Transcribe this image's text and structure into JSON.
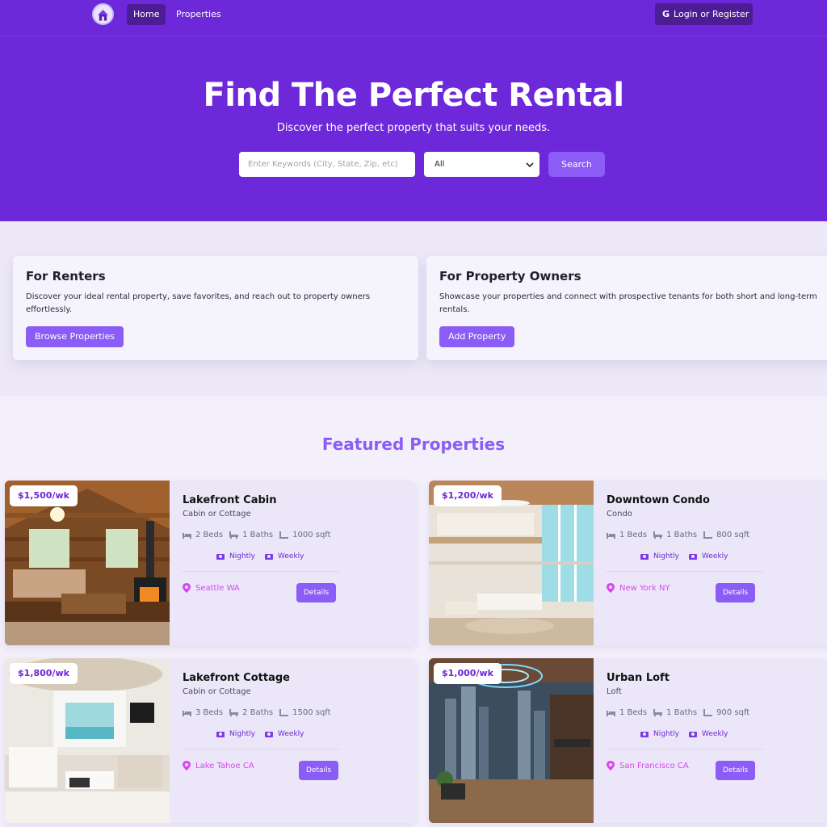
{
  "nav": {
    "logo_icon": "house-logo-icon",
    "links": [
      {
        "label": "Home",
        "active": true
      },
      {
        "label": "Properties",
        "active": false
      }
    ],
    "login_label": "Login or Register",
    "login_icon": "google-icon"
  },
  "hero": {
    "title": "Find The Perfect Rental",
    "subtitle": "Discover the perfect property that suits your needs.",
    "search_placeholder": "Enter Keywords (City, State, Zip, etc)",
    "type_selected": "All",
    "search_button": "Search"
  },
  "info": {
    "renters": {
      "title": "For Renters",
      "text": "Discover your ideal rental property, save favorites, and reach out to property owners effortlessly.",
      "button": "Browse Properties"
    },
    "owners": {
      "title": "For Property Owners",
      "text": "Showcase your properties and connect with prospective tenants for both short and long-term rentals.",
      "button": "Add Property"
    }
  },
  "featured": {
    "title": "Featured Properties",
    "properties": [
      {
        "price": "$1,500/wk",
        "name": "Lakefront Cabin",
        "type": "Cabin or Cottage",
        "beds": "2 Beds",
        "baths": "1 Baths",
        "sqft": "1000 sqft",
        "rate1": "Nightly",
        "rate2": "Weekly",
        "location": "Seattle WA",
        "details": "Details"
      },
      {
        "price": "$1,200/wk",
        "name": "Downtown Condo",
        "type": "Condo",
        "beds": "1 Beds",
        "baths": "1 Baths",
        "sqft": "800 sqft",
        "rate1": "Nightly",
        "rate2": "Weekly",
        "location": "New York NY",
        "details": "Details"
      },
      {
        "price": "$1,800/wk",
        "name": "Lakefront Cottage",
        "type": "Cabin or Cottage",
        "beds": "3 Beds",
        "baths": "2 Baths",
        "sqft": "1500 sqft",
        "rate1": "Nightly",
        "rate2": "Weekly",
        "location": "Lake Tahoe CA",
        "details": "Details"
      },
      {
        "price": "$1,000/wk",
        "name": "Urban Loft",
        "type": "Loft",
        "beds": "1 Beds",
        "baths": "1 Baths",
        "sqft": "900 sqft",
        "rate1": "Nightly",
        "rate2": "Weekly",
        "location": "San Francisco CA",
        "details": "Details"
      }
    ]
  },
  "colors": {
    "brand": "#6d28d9",
    "accent": "#8b5cf6",
    "location": "#d946ef"
  }
}
